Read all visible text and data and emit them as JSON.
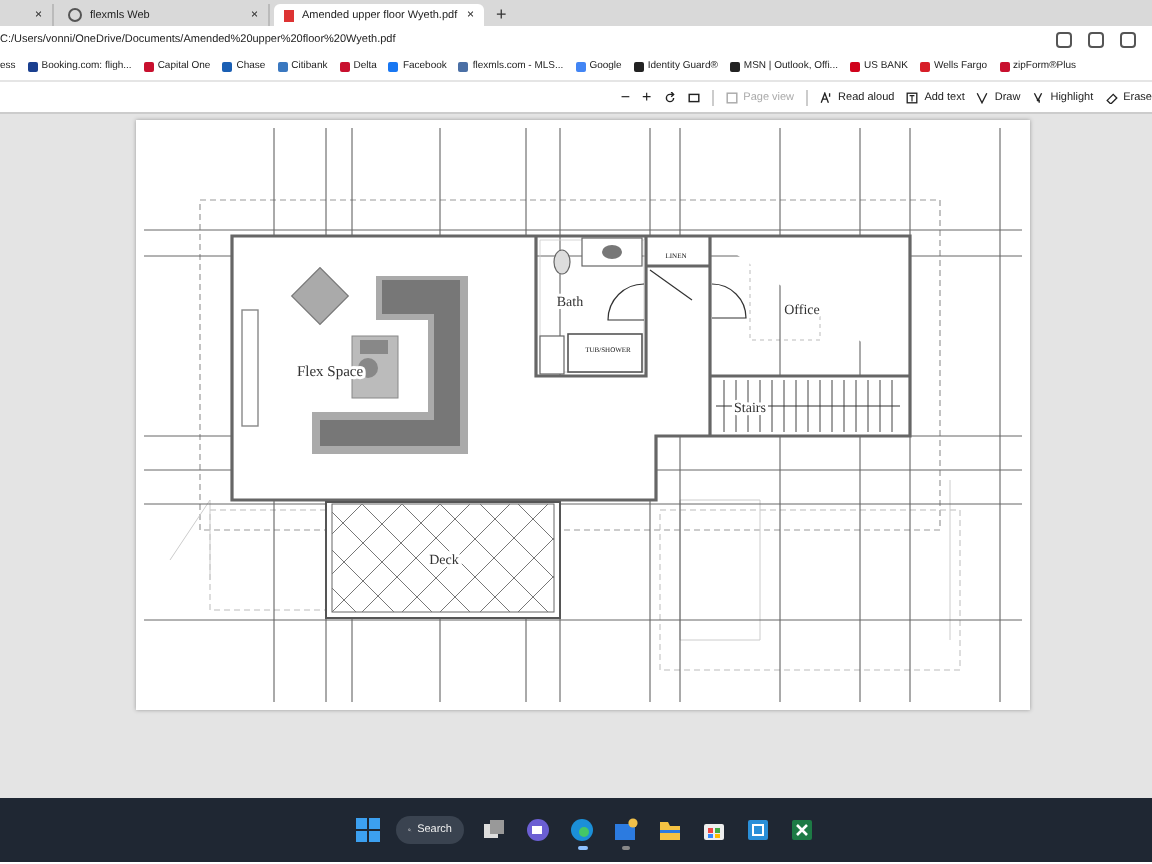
{
  "tabs": [
    {
      "close": "×",
      "selected": false
    },
    {
      "label": "flexmls Web",
      "close": "×",
      "selected": false
    },
    {
      "label": "Amended upper floor Wyeth.pdf",
      "close": "×",
      "selected": true
    }
  ],
  "new_tab": "+",
  "address": "C:/Users/vonni/OneDrive/Documents/Amended%20upper%20floor%20Wyeth.pdf",
  "bookmarks": [
    {
      "label": "ess"
    },
    {
      "label": "Booking.com: fligh...",
      "color": "#1a3f8f"
    },
    {
      "label": "Capital One",
      "color": "#c8102e"
    },
    {
      "label": "Chase",
      "color": "#1a5fb4"
    },
    {
      "label": "Citibank",
      "color": "#3a78c0"
    },
    {
      "label": "Delta",
      "color": "#c8102e"
    },
    {
      "label": "Facebook",
      "color": "#1877f2"
    },
    {
      "label": "flexmls.com - MLS...",
      "color": "#4a6fa5"
    },
    {
      "label": "Google",
      "color": "#4285f4"
    },
    {
      "label": "Identity Guard®",
      "color": "#222222"
    },
    {
      "label": "MSN | Outlook, Offi...",
      "color": "#222222"
    },
    {
      "label": "US BANK",
      "color": "#d0021b"
    },
    {
      "label": "Wells Fargo",
      "color": "#d71e28"
    },
    {
      "label": "zipForm®Plus",
      "color": "#c8102e"
    }
  ],
  "pdf_toolbar": [
    {
      "kind": "zoom-out",
      "label": "−",
      "disabled": false
    },
    {
      "kind": "zoom-in",
      "label": "+",
      "disabled": false
    },
    {
      "kind": "rotate",
      "disabled": false
    },
    {
      "kind": "fit",
      "disabled": false
    },
    {
      "kind": "page-view",
      "label": "Page view",
      "disabled": true
    },
    {
      "kind": "read-aloud",
      "label": "Read aloud",
      "disabled": false
    },
    {
      "kind": "add-text",
      "label": "Add text",
      "disabled": false
    },
    {
      "kind": "draw",
      "label": "Draw",
      "disabled": false
    },
    {
      "kind": "highlight",
      "label": "Highlight",
      "disabled": false
    },
    {
      "kind": "erase",
      "label": "Erase",
      "disabled": false
    }
  ],
  "floor_plan": {
    "labels": [
      {
        "kind": "room",
        "text": "Flex Space"
      },
      {
        "kind": "room",
        "text": "Bath"
      },
      {
        "kind": "room",
        "text": "Office"
      },
      {
        "kind": "room",
        "text": "Stairs"
      },
      {
        "kind": "room",
        "text": "Deck"
      },
      {
        "kind": "fixture",
        "text": "LINEN"
      },
      {
        "kind": "fixture",
        "text": "TUB/SHOWER"
      }
    ]
  },
  "taskbar": {
    "search": "Search",
    "apps": [
      {
        "kind": "taskview",
        "running": false
      },
      {
        "kind": "chat",
        "running": false
      },
      {
        "kind": "edge",
        "running": true
      },
      {
        "kind": "mail",
        "running": true
      },
      {
        "kind": "files",
        "running": false
      },
      {
        "kind": "store",
        "running": false
      },
      {
        "kind": "app",
        "running": false
      },
      {
        "kind": "excel",
        "running": false
      }
    ]
  }
}
